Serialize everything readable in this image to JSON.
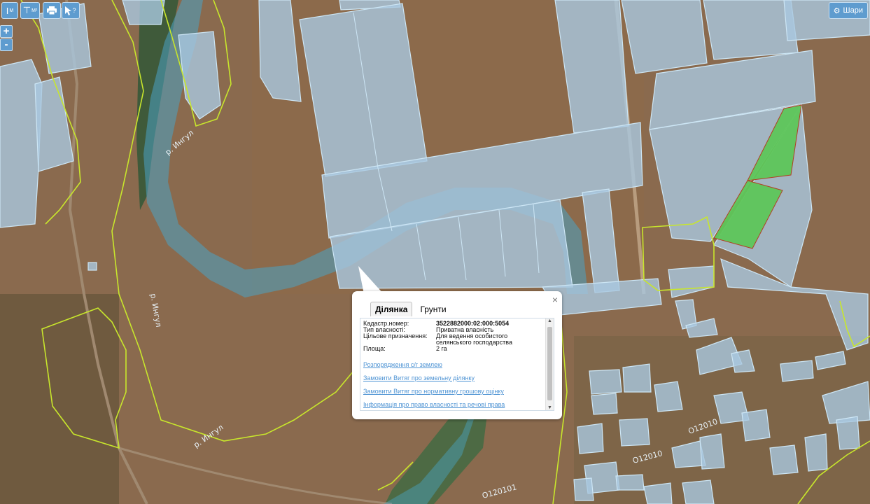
{
  "toolbar": {
    "measure_length_label": "I",
    "measure_length_unit": "М",
    "measure_area_label": "⊤",
    "measure_area_unit": "М²",
    "print_icon": "printer-icon",
    "identify_icon": "cursor-question-icon",
    "identify_label": "?"
  },
  "zoom": {
    "in_label": "+",
    "out_label": "-"
  },
  "layers_button": {
    "label": "Шари",
    "icon": "gear-icon"
  },
  "map_labels": {
    "river_1": "р. Ингул",
    "river_2": "р. Ингул",
    "river_3": "р. Ингул",
    "road_1": "О12010",
    "road_2": "О12010",
    "road_3": "О120101"
  },
  "colors": {
    "parcel_fill": "#a9c8e0",
    "parcel_stroke": "#cde6f5",
    "boundary": "#c8e62c",
    "selected_fill": "#5ec65a",
    "selected_stroke": "#b23a1b",
    "river_fill": "#4aa3c4"
  },
  "popup": {
    "tabs": [
      {
        "label": "Ділянка"
      },
      {
        "label": "Грунти"
      }
    ],
    "close_label": "×",
    "fields": [
      {
        "key": "Кадастр.номер:",
        "value": "3522882000:02:000:5054"
      },
      {
        "key": "Тип власності:",
        "value": "Приватна власність"
      },
      {
        "key": "Цільове призначення:",
        "value": "Для ведення особистого селянського господарства"
      },
      {
        "key": "Площа:",
        "value": "2 га"
      }
    ],
    "links": [
      "Розпорядження с/г землею",
      "Замовити Витяг про земельну ділянку",
      "Замовити Витяг про нормативну грошову оцінку",
      "Інформація про право власності та речові права"
    ]
  }
}
